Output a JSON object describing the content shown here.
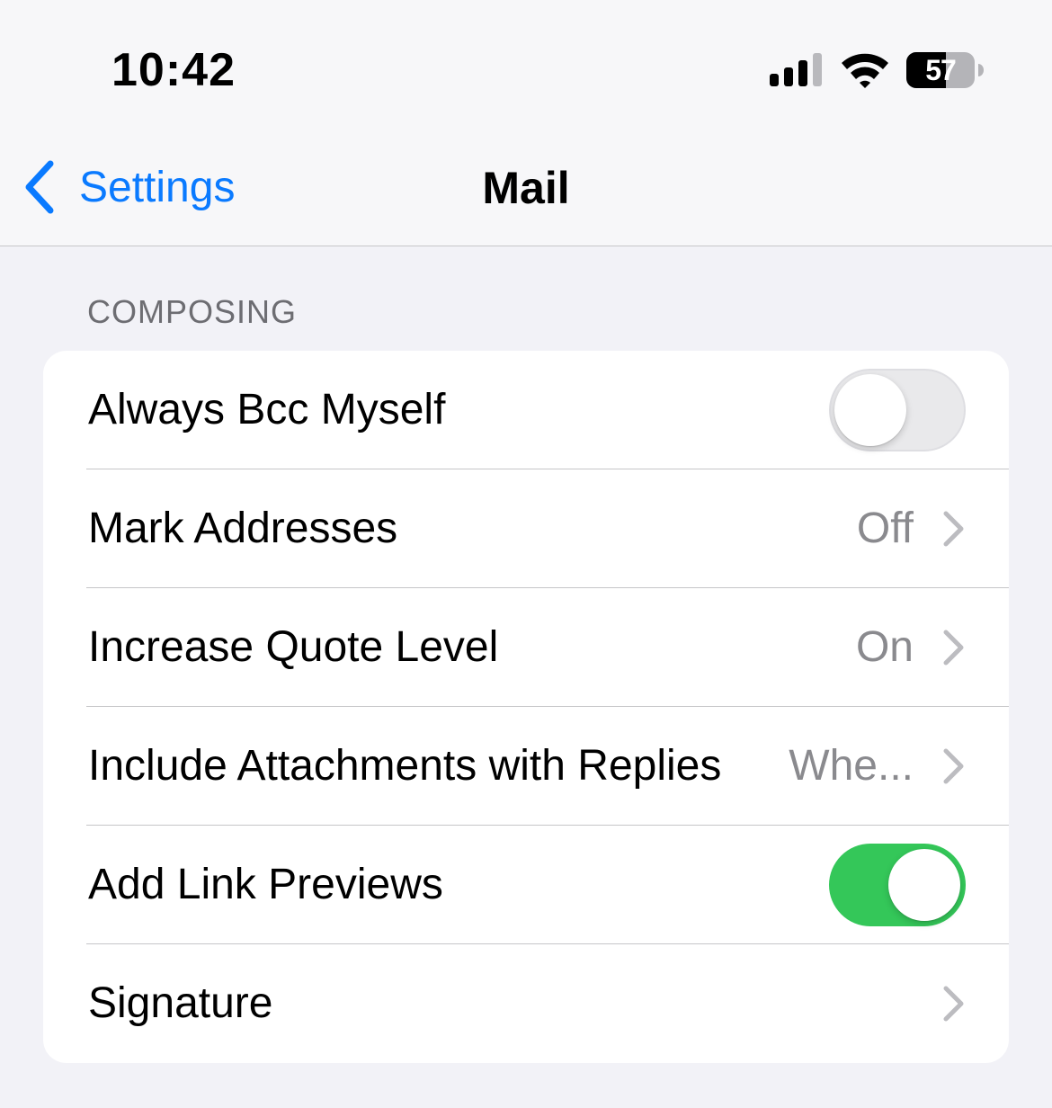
{
  "status_bar": {
    "time": "10:42",
    "battery_level": "57",
    "signal_icon": "cellular-signal-icon",
    "wifi_icon": "wifi-icon",
    "battery_icon": "battery-icon"
  },
  "nav": {
    "back_label": "Settings",
    "back_icon": "chevron-left-icon",
    "title": "Mail"
  },
  "composing": {
    "header": "COMPOSING",
    "rows": [
      {
        "label": "Always Bcc Myself",
        "type": "toggle",
        "on": false
      },
      {
        "label": "Mark Addresses",
        "type": "disclosure",
        "value": "Off"
      },
      {
        "label": "Increase Quote Level",
        "type": "disclosure",
        "value": "On"
      },
      {
        "label": "Include Attachments with Replies",
        "type": "disclosure",
        "value": "Whe..."
      },
      {
        "label": "Add Link Previews",
        "type": "toggle",
        "on": true
      },
      {
        "label": "Signature",
        "type": "disclosure",
        "value": ""
      }
    ]
  },
  "colors": {
    "accent": "#0a7aff",
    "toggle_on": "#34c759",
    "background": "#f2f2f7"
  }
}
